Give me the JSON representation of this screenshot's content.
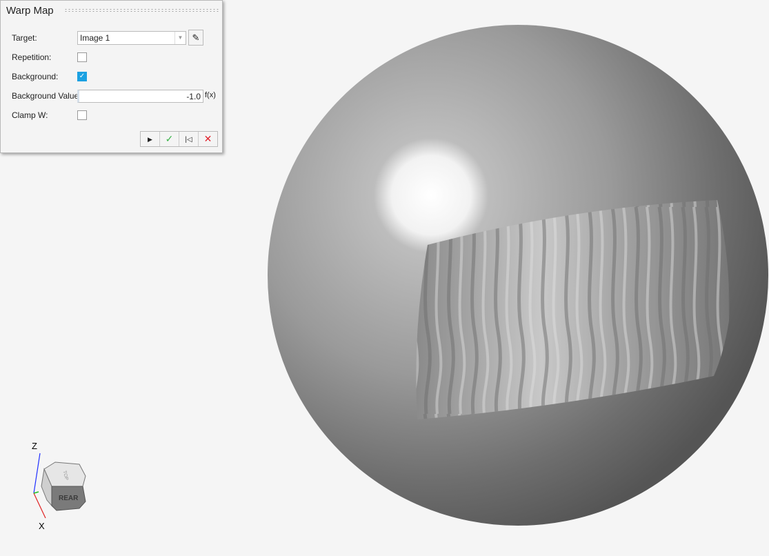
{
  "panel": {
    "title": "Warp Map",
    "target_label": "Target:",
    "target_value": "Image 1",
    "repetition_label": "Repetition:",
    "repetition_checked": false,
    "background_label": "Background:",
    "background_checked": true,
    "background_value_label": "Background Value:",
    "background_value": "-1.0",
    "fx_label": "f(x)",
    "clamp_label": "Clamp W:",
    "clamp_checked": false,
    "icons": {
      "run": "play-icon",
      "apply": "check-icon",
      "reset": "skip-back-icon",
      "close": "close-icon"
    }
  },
  "triad": {
    "z": "Z",
    "x": "X",
    "cube_top": "TOP",
    "cube_front": "REAR"
  }
}
